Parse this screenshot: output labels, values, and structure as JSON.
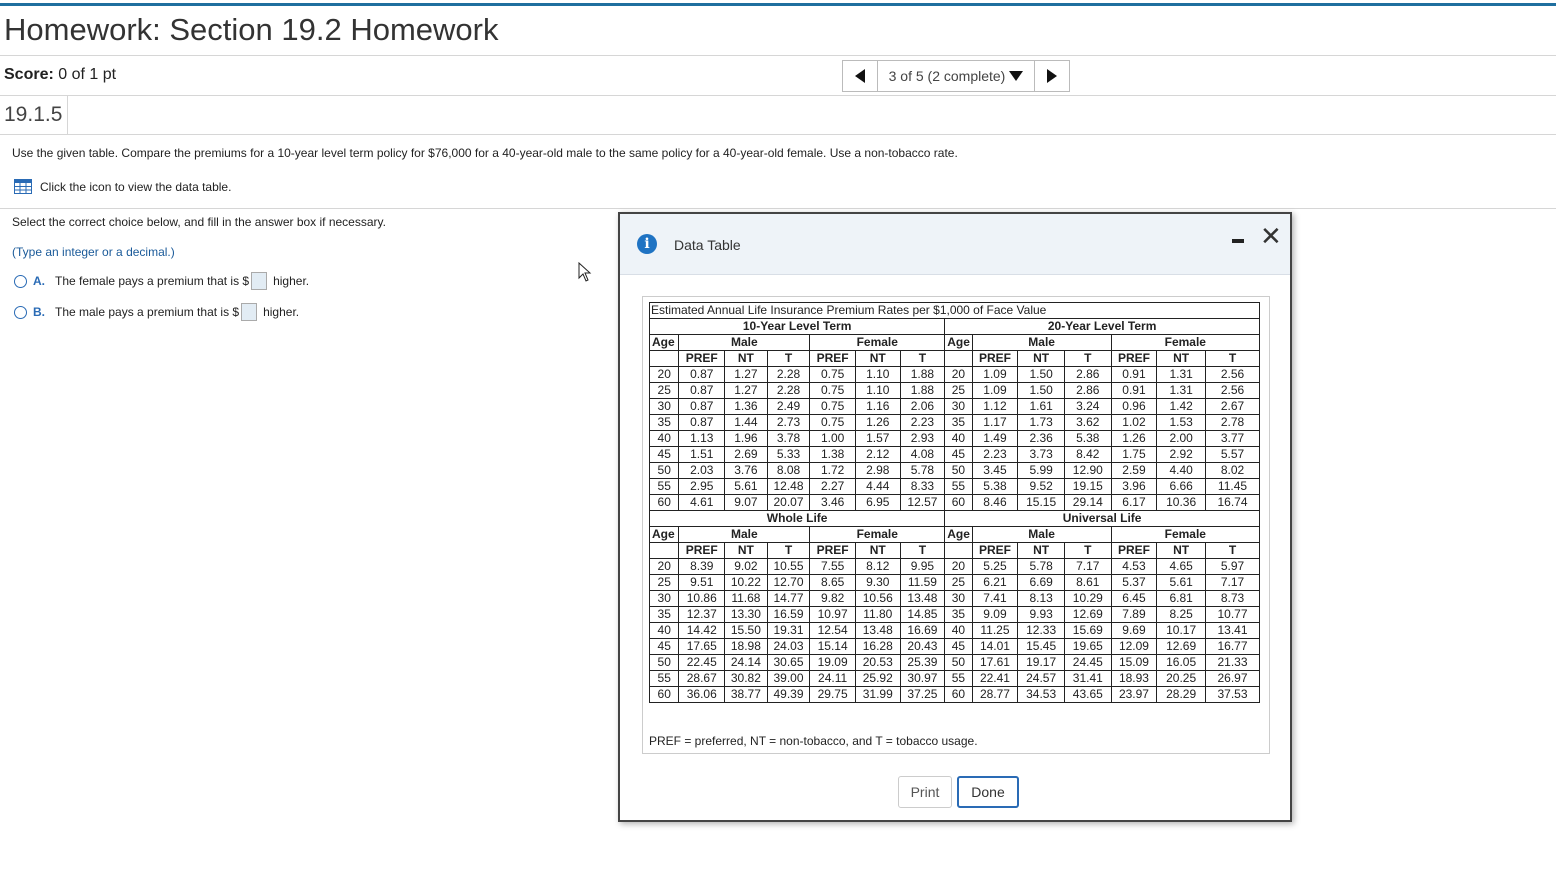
{
  "header": {
    "title": "Homework: Section 19.2 Homework",
    "score_label": "Score:",
    "score_value": "0 of 1 pt",
    "nav_progress": "3 of 5 (2 complete)"
  },
  "question": {
    "number": "19.1.5",
    "text": "Use the given table. Compare the premiums for a 10-year level term policy for $76,000 for a 40-year-old male to the same policy for a 40-year-old female. Use a non-tobacco rate.",
    "click_icon_text": "Click the icon to view the data table.",
    "select_text": "Select the correct choice below, and fill in the answer box if necessary.",
    "hint": "(Type an integer or a decimal.)",
    "choice_a_letter": "A.",
    "choice_a_prefix": "The female pays a premium that is $",
    "choice_a_suffix": "higher.",
    "choice_b_letter": "B.",
    "choice_b_prefix": "The male pays a premium that is $",
    "choice_b_suffix": "higher."
  },
  "dialog": {
    "title": "Data Table",
    "print_label": "Print",
    "done_label": "Done",
    "table_caption": "Estimated Annual Life Insurance Premium Rates per $1,000 of Face Value",
    "footnote": "PREF = preferred, NT = non-tobacco, and T = tobacco usage.",
    "age_label": "Age",
    "male_label": "Male",
    "female_label": "Female",
    "col_pref": "PREF",
    "col_nt": "NT",
    "col_t": "T",
    "sections": [
      {
        "left_title": "10-Year Level Term",
        "right_title": "20-Year Level Term",
        "rows": [
          [
            "20",
            "0.87",
            "1.27",
            "2.28",
            "0.75",
            "1.10",
            "1.88",
            "20",
            "1.09",
            "1.50",
            "2.86",
            "0.91",
            "1.31",
            "2.56"
          ],
          [
            "25",
            "0.87",
            "1.27",
            "2.28",
            "0.75",
            "1.10",
            "1.88",
            "25",
            "1.09",
            "1.50",
            "2.86",
            "0.91",
            "1.31",
            "2.56"
          ],
          [
            "30",
            "0.87",
            "1.36",
            "2.49",
            "0.75",
            "1.16",
            "2.06",
            "30",
            "1.12",
            "1.61",
            "3.24",
            "0.96",
            "1.42",
            "2.67"
          ],
          [
            "35",
            "0.87",
            "1.44",
            "2.73",
            "0.75",
            "1.26",
            "2.23",
            "35",
            "1.17",
            "1.73",
            "3.62",
            "1.02",
            "1.53",
            "2.78"
          ],
          [
            "40",
            "1.13",
            "1.96",
            "3.78",
            "1.00",
            "1.57",
            "2.93",
            "40",
            "1.49",
            "2.36",
            "5.38",
            "1.26",
            "2.00",
            "3.77"
          ],
          [
            "45",
            "1.51",
            "2.69",
            "5.33",
            "1.38",
            "2.12",
            "4.08",
            "45",
            "2.23",
            "3.73",
            "8.42",
            "1.75",
            "2.92",
            "5.57"
          ],
          [
            "50",
            "2.03",
            "3.76",
            "8.08",
            "1.72",
            "2.98",
            "5.78",
            "50",
            "3.45",
            "5.99",
            "12.90",
            "2.59",
            "4.40",
            "8.02"
          ],
          [
            "55",
            "2.95",
            "5.61",
            "12.48",
            "2.27",
            "4.44",
            "8.33",
            "55",
            "5.38",
            "9.52",
            "19.15",
            "3.96",
            "6.66",
            "11.45"
          ],
          [
            "60",
            "4.61",
            "9.07",
            "20.07",
            "3.46",
            "6.95",
            "12.57",
            "60",
            "8.46",
            "15.15",
            "29.14",
            "6.17",
            "10.36",
            "16.74"
          ]
        ]
      },
      {
        "left_title": "Whole Life",
        "right_title": "Universal Life",
        "rows": [
          [
            "20",
            "8.39",
            "9.02",
            "10.55",
            "7.55",
            "8.12",
            "9.95",
            "20",
            "5.25",
            "5.78",
            "7.17",
            "4.53",
            "4.65",
            "5.97"
          ],
          [
            "25",
            "9.51",
            "10.22",
            "12.70",
            "8.65",
            "9.30",
            "11.59",
            "25",
            "6.21",
            "6.69",
            "8.61",
            "5.37",
            "5.61",
            "7.17"
          ],
          [
            "30",
            "10.86",
            "11.68",
            "14.77",
            "9.82",
            "10.56",
            "13.48",
            "30",
            "7.41",
            "8.13",
            "10.29",
            "6.45",
            "6.81",
            "8.73"
          ],
          [
            "35",
            "12.37",
            "13.30",
            "16.59",
            "10.97",
            "11.80",
            "14.85",
            "35",
            "9.09",
            "9.93",
            "12.69",
            "7.89",
            "8.25",
            "10.77"
          ],
          [
            "40",
            "14.42",
            "15.50",
            "19.31",
            "12.54",
            "13.48",
            "16.69",
            "40",
            "11.25",
            "12.33",
            "15.69",
            "9.69",
            "10.17",
            "13.41"
          ],
          [
            "45",
            "17.65",
            "18.98",
            "24.03",
            "15.14",
            "16.28",
            "20.43",
            "45",
            "14.01",
            "15.45",
            "19.65",
            "12.09",
            "12.69",
            "16.77"
          ],
          [
            "50",
            "22.45",
            "24.14",
            "30.65",
            "19.09",
            "20.53",
            "25.39",
            "50",
            "17.61",
            "19.17",
            "24.45",
            "15.09",
            "16.05",
            "21.33"
          ],
          [
            "55",
            "28.67",
            "30.82",
            "39.00",
            "24.11",
            "25.92",
            "30.97",
            "55",
            "22.41",
            "24.57",
            "31.41",
            "18.93",
            "20.25",
            "26.97"
          ],
          [
            "60",
            "36.06",
            "38.77",
            "49.39",
            "29.75",
            "31.99",
            "37.25",
            "60",
            "28.77",
            "34.53",
            "43.65",
            "23.97",
            "28.29",
            "37.53"
          ]
        ]
      }
    ]
  }
}
